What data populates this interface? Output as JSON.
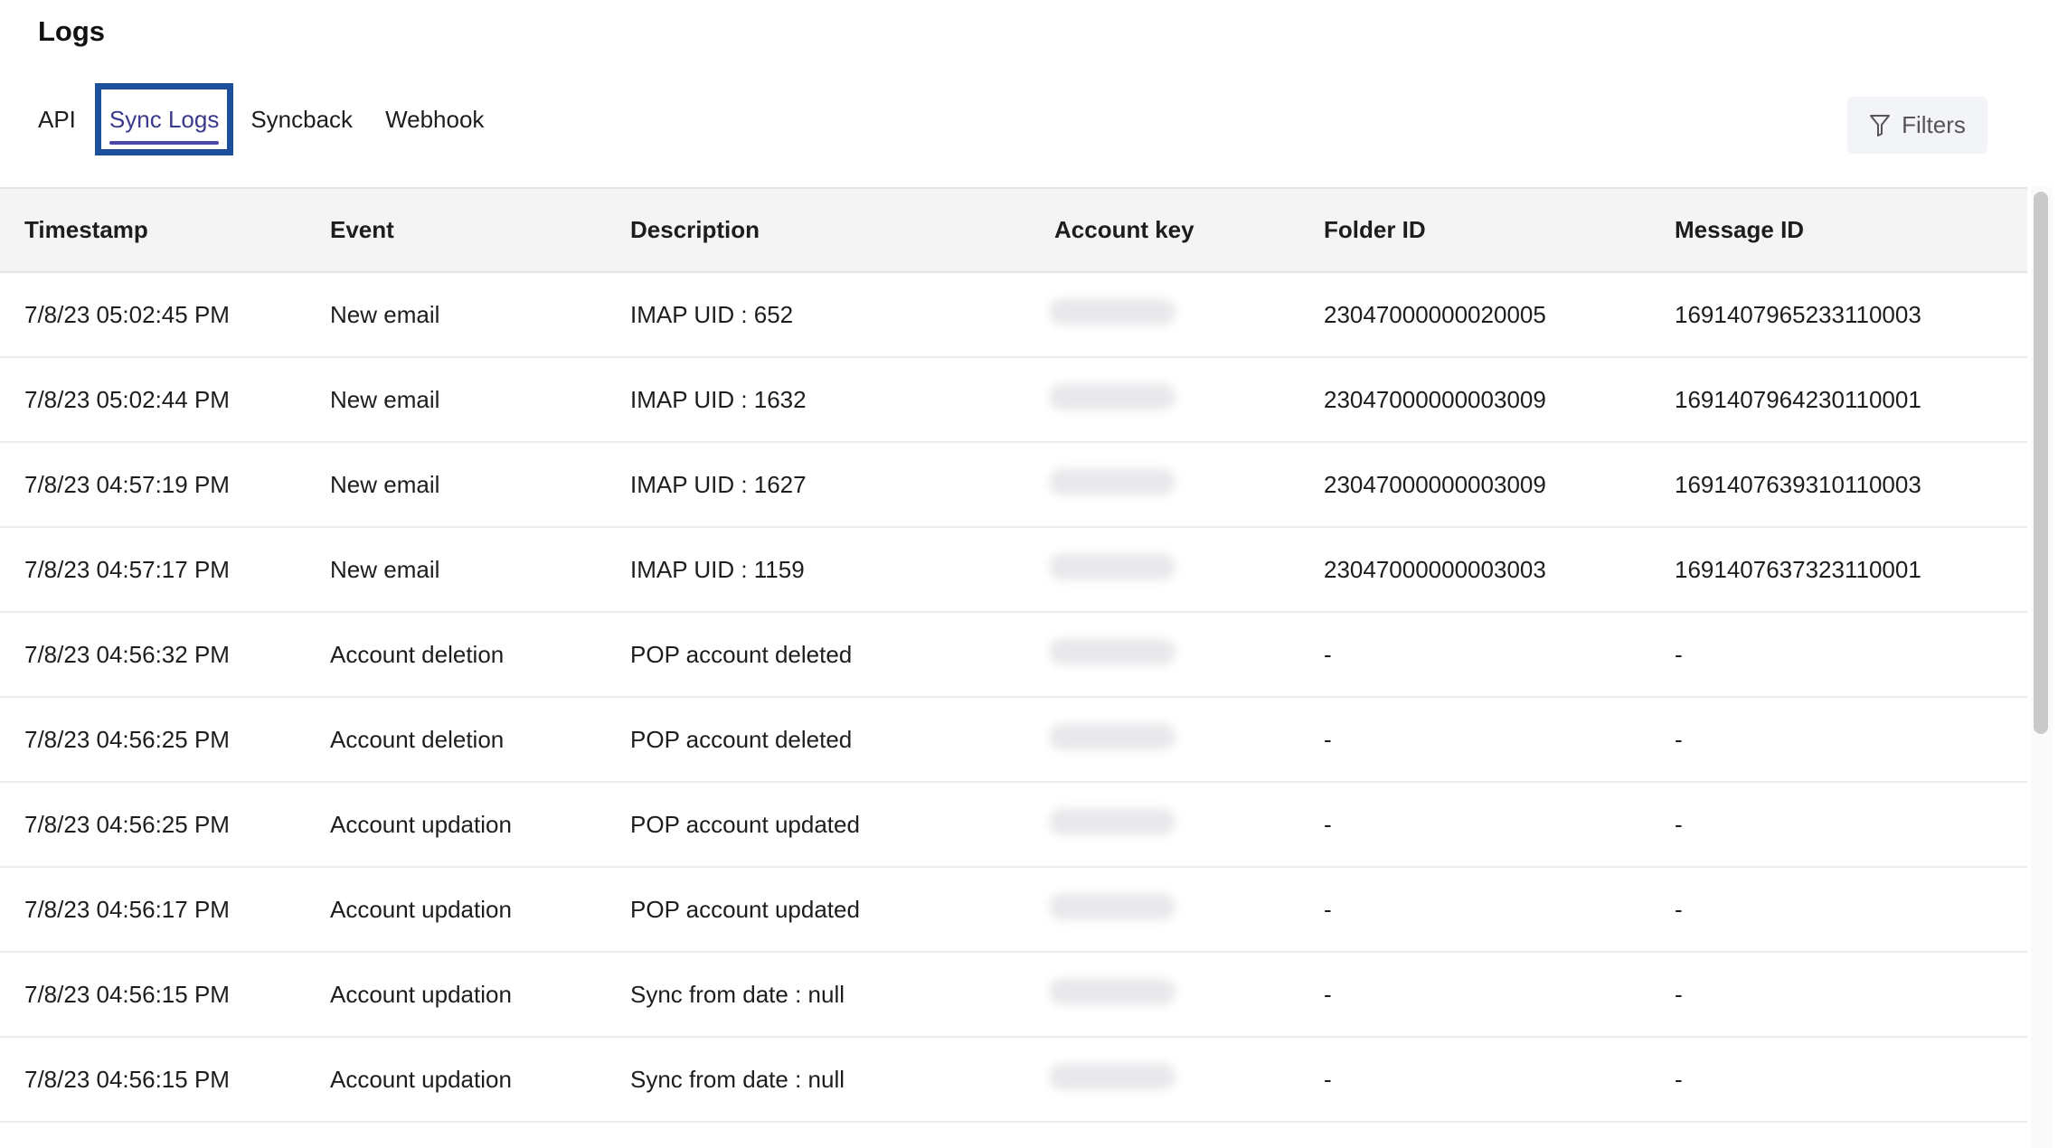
{
  "page": {
    "title": "Logs"
  },
  "tabs": [
    {
      "label": "API",
      "active": false
    },
    {
      "label": "Sync Logs",
      "active": true
    },
    {
      "label": "Syncback",
      "active": false
    },
    {
      "label": "Webhook",
      "active": false
    }
  ],
  "filters": {
    "label": "Filters",
    "icon": "filter-icon"
  },
  "table": {
    "columns": [
      "Timestamp",
      "Event",
      "Description",
      "Account key",
      "Folder ID",
      "Message ID"
    ],
    "rows": [
      {
        "timestamp": "7/8/23 05:02:45 PM",
        "event": "New email",
        "description": "IMAP UID : 652",
        "folder_id": "23047000000020005",
        "message_id": "1691407965233110003"
      },
      {
        "timestamp": "7/8/23 05:02:44 PM",
        "event": "New email",
        "description": "IMAP UID : 1632",
        "folder_id": "23047000000003009",
        "message_id": "1691407964230110001"
      },
      {
        "timestamp": "7/8/23 04:57:19 PM",
        "event": "New email",
        "description": "IMAP UID : 1627",
        "folder_id": "23047000000003009",
        "message_id": "1691407639310110003"
      },
      {
        "timestamp": "7/8/23 04:57:17 PM",
        "event": "New email",
        "description": "IMAP UID : 1159",
        "folder_id": "23047000000003003",
        "message_id": "1691407637323110001"
      },
      {
        "timestamp": "7/8/23 04:56:32 PM",
        "event": "Account deletion",
        "description": "POP account deleted",
        "folder_id": "-",
        "message_id": "-"
      },
      {
        "timestamp": "7/8/23 04:56:25 PM",
        "event": "Account deletion",
        "description": "POP account deleted",
        "folder_id": "-",
        "message_id": "-"
      },
      {
        "timestamp": "7/8/23 04:56:25 PM",
        "event": "Account updation",
        "description": "POP account updated",
        "folder_id": "-",
        "message_id": "-"
      },
      {
        "timestamp": "7/8/23 04:56:17 PM",
        "event": "Account updation",
        "description": "POP account updated",
        "folder_id": "-",
        "message_id": "-"
      },
      {
        "timestamp": "7/8/23 04:56:15 PM",
        "event": "Account updation",
        "description": "Sync from date : null",
        "folder_id": "-",
        "message_id": "-"
      },
      {
        "timestamp": "7/8/23 04:56:15 PM",
        "event": "Account updation",
        "description": "Sync from date : null",
        "folder_id": "-",
        "message_id": "-"
      }
    ]
  },
  "colors": {
    "active_tab_text": "#3a3a8c",
    "active_tab_underline": "#4a49a6",
    "focus_outline": "#1d4f9a",
    "header_background": "#f4f4f4",
    "filters_background": "#f2f4f8"
  }
}
